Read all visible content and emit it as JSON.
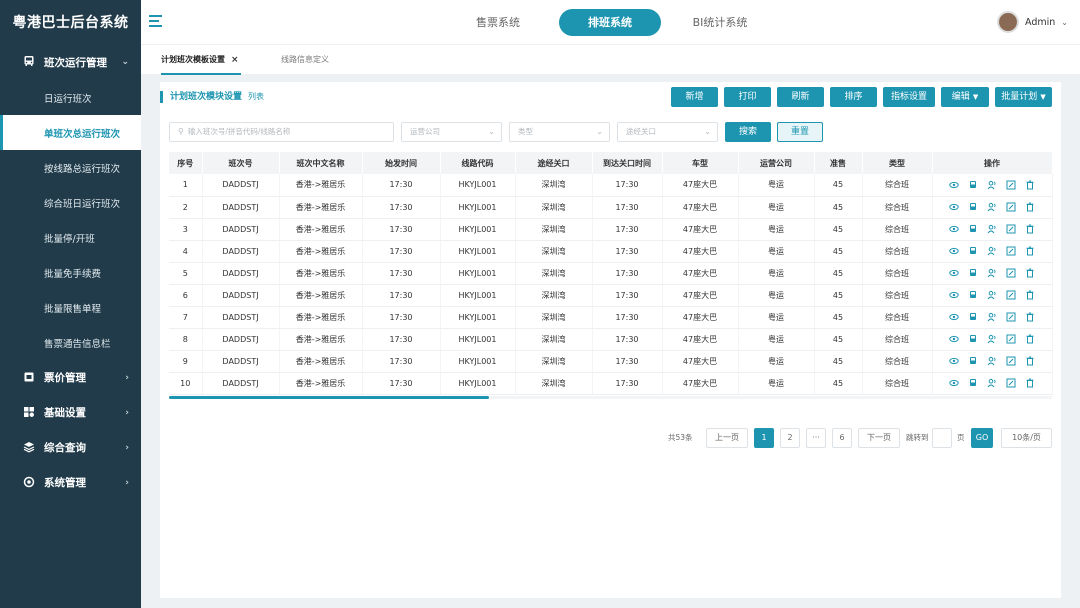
{
  "app": {
    "title": "粤港巴士后台系统"
  },
  "sidebar": {
    "groups": [
      {
        "label": "班次运行管理",
        "icon": "bus-icon"
      },
      {
        "label": "票价管理",
        "icon": "ticket-icon"
      },
      {
        "label": "基础设置",
        "icon": "settings-grid-icon"
      },
      {
        "label": "综合查询",
        "icon": "layers-icon"
      },
      {
        "label": "系统管理",
        "icon": "gear-icon"
      }
    ],
    "items": [
      "日运行班次",
      "单班次总运行班次",
      "按线路总运行班次",
      "综合班日运行班次",
      "批量停/开班",
      "批量免手续费",
      "批量限售单程",
      "售票通告信息栏"
    ]
  },
  "topbar": {
    "tabs": [
      "售票系统",
      "排班系统",
      "BI统计系统"
    ],
    "active_tab": "排班系统",
    "user": "Admin"
  },
  "pagetabs": [
    "计划班次模板设置",
    "线路信息定义"
  ],
  "card": {
    "title": "计划班次模块设置",
    "subtitle": "列表",
    "buttons": [
      "新增",
      "打印",
      "刷新",
      "排序",
      "指标设置",
      "编辑",
      "批量计划"
    ],
    "search_placeholder": "输入班次号/拼音代码/线路名称",
    "filters": [
      "运营公司",
      "类型",
      "途经关口"
    ],
    "search_label": "搜索",
    "reset_label": "重置"
  },
  "table": {
    "headers": [
      "序号",
      "班次号",
      "班次中文名称",
      "始发时间",
      "线路代码",
      "途经关口",
      "到达关口时间",
      "车型",
      "运营公司",
      "准售",
      "类型",
      "操作"
    ],
    "rows": [
      [
        "1",
        "DADDSTJ",
        "香港->雅居乐",
        "17:30",
        "HKYJL001",
        "深圳湾",
        "17:30",
        "47座大巴",
        "粤运",
        "45",
        "综合班"
      ],
      [
        "2",
        "DADDSTJ",
        "香港->雅居乐",
        "17:30",
        "HKYJL001",
        "深圳湾",
        "17:30",
        "47座大巴",
        "粤运",
        "45",
        "综合班"
      ],
      [
        "3",
        "DADDSTJ",
        "香港->雅居乐",
        "17:30",
        "HKYJL001",
        "深圳湾",
        "17:30",
        "47座大巴",
        "粤运",
        "45",
        "综合班"
      ],
      [
        "4",
        "DADDSTJ",
        "香港->雅居乐",
        "17:30",
        "HKYJL001",
        "深圳湾",
        "17:30",
        "47座大巴",
        "粤运",
        "45",
        "综合班"
      ],
      [
        "5",
        "DADDSTJ",
        "香港->雅居乐",
        "17:30",
        "HKYJL001",
        "深圳湾",
        "17:30",
        "47座大巴",
        "粤运",
        "45",
        "综合班"
      ],
      [
        "6",
        "DADDSTJ",
        "香港->雅居乐",
        "17:30",
        "HKYJL001",
        "深圳湾",
        "17:30",
        "47座大巴",
        "粤运",
        "45",
        "综合班"
      ],
      [
        "7",
        "DADDSTJ",
        "香港->雅居乐",
        "17:30",
        "HKYJL001",
        "深圳湾",
        "17:30",
        "47座大巴",
        "粤运",
        "45",
        "综合班"
      ],
      [
        "8",
        "DADDSTJ",
        "香港->雅居乐",
        "17:30",
        "HKYJL001",
        "深圳湾",
        "17:30",
        "47座大巴",
        "粤运",
        "45",
        "综合班"
      ],
      [
        "9",
        "DADDSTJ",
        "香港->雅居乐",
        "17:30",
        "HKYJL001",
        "深圳湾",
        "17:30",
        "47座大巴",
        "粤运",
        "45",
        "综合班"
      ],
      [
        "10",
        "DADDSTJ",
        "香港->雅居乐",
        "17:30",
        "HKYJL001",
        "深圳湾",
        "17:30",
        "47座大巴",
        "粤运",
        "45",
        "综合班"
      ]
    ],
    "op_icons": [
      "eye-icon",
      "bus-icon",
      "users-icon",
      "edit-icon",
      "trash-icon"
    ]
  },
  "pager": {
    "total": "共53条",
    "prev": "上一页",
    "pages": [
      "1",
      "2",
      "···",
      "6"
    ],
    "next": "下一页",
    "goto_label": "跳转到",
    "page_unit": "页",
    "go": "GO",
    "page_size": "10条/页"
  },
  "colors": {
    "accent": "#1d95b0",
    "sidebar": "#213b4a"
  }
}
